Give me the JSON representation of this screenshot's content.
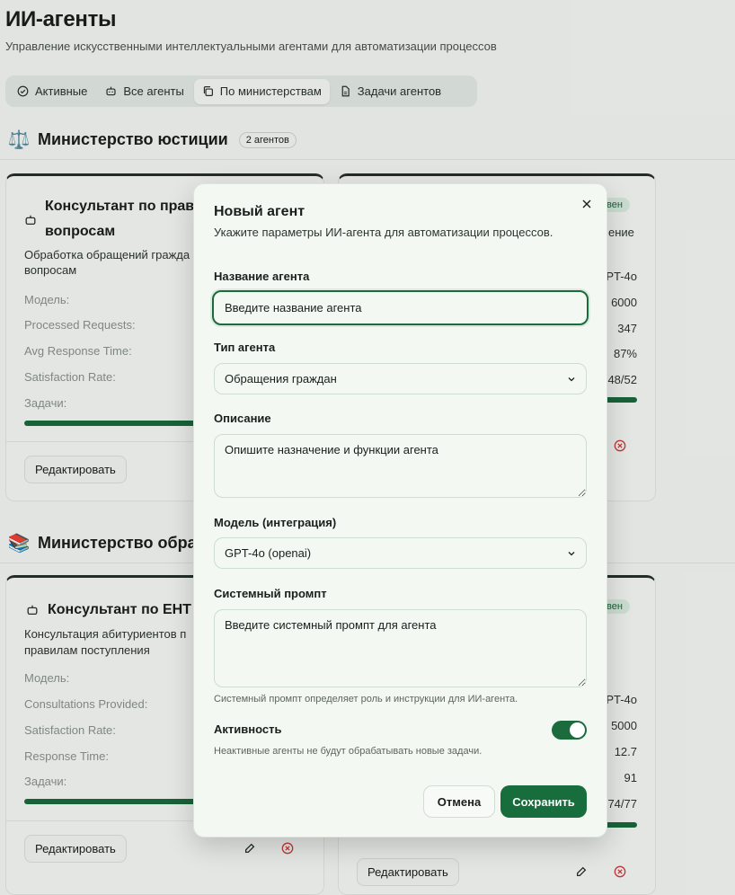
{
  "page": {
    "title": "ИИ-агенты",
    "subtitle": "Управление искусственными интеллектуальными агентами для автоматизации процессов"
  },
  "tabs": [
    {
      "label": "Активные",
      "icon": "check-circle-icon"
    },
    {
      "label": "Все агенты",
      "icon": "robot-icon"
    },
    {
      "label": "По министерствам",
      "icon": "copy-icon",
      "active": true
    },
    {
      "label": "Задачи агентов",
      "icon": "file-icon"
    }
  ],
  "sections": [
    {
      "emoji": "⚖️",
      "name": "Министерство юстиции",
      "badge": "2 агентов",
      "card_left": {
        "title_line1": "Консультант по правов",
        "title_line2": "вопросам",
        "desc_line1": "Обработка обращений гражда",
        "desc_line2": "вопросам",
        "rows": [
          "Модель:",
          "Processed Requests:",
          "Avg Response Time:",
          "Satisfaction Rate:",
          "Задачи:"
        ],
        "edit_label": "Редактировать"
      },
      "card_right": {
        "status": "вен",
        "desc_fragment": "ение",
        "values": [
          "PT-4o",
          "6000",
          "347",
          "87%",
          "48/52"
        ]
      }
    },
    {
      "emoji": "📚",
      "name": "Министерство образ",
      "card_left": {
        "title": "Консультант по ЕНТ",
        "desc_line1": "Консультация абитуриентов п",
        "desc_line2": "правилам поступления",
        "rows": [
          "Модель:",
          "Consultations Provided:",
          "Satisfaction Rate:",
          "Response Time:",
          "Задачи:"
        ],
        "edit_label": "Редактировать"
      },
      "card_right": {
        "status": "вен",
        "values": [
          "PT-4o",
          "5000",
          "12.7",
          "91",
          "74/77"
        ],
        "edit_label": "Редактировать"
      }
    }
  ],
  "modal": {
    "title": "Новый агент",
    "description": "Укажите параметры ИИ-агента для автоматизации процессов.",
    "name_label": "Название агента",
    "name_placeholder": "Введите название агента",
    "type_label": "Тип агента",
    "type_value": "Обращения граждан",
    "desc_label": "Описание",
    "desc_placeholder": "Опишите назначение и функции агента",
    "model_label": "Модель (интеграция)",
    "model_value": "GPT-4o (openai)",
    "prompt_label": "Системный промпт",
    "prompt_placeholder": "Введите системный промпт для агента",
    "prompt_hint": "Системный промпт определяет роль и инструкции для ИИ-агента.",
    "active_label": "Активность",
    "active_value": true,
    "active_hint": "Неактивные агенты не будут обрабатывать новые задачи.",
    "cancel_label": "Отмена",
    "save_label": "Сохранить"
  },
  "colors": {
    "accent": "#176d3b",
    "background": "#f6f8f6",
    "modal_bg": "#f3f8f3"
  }
}
